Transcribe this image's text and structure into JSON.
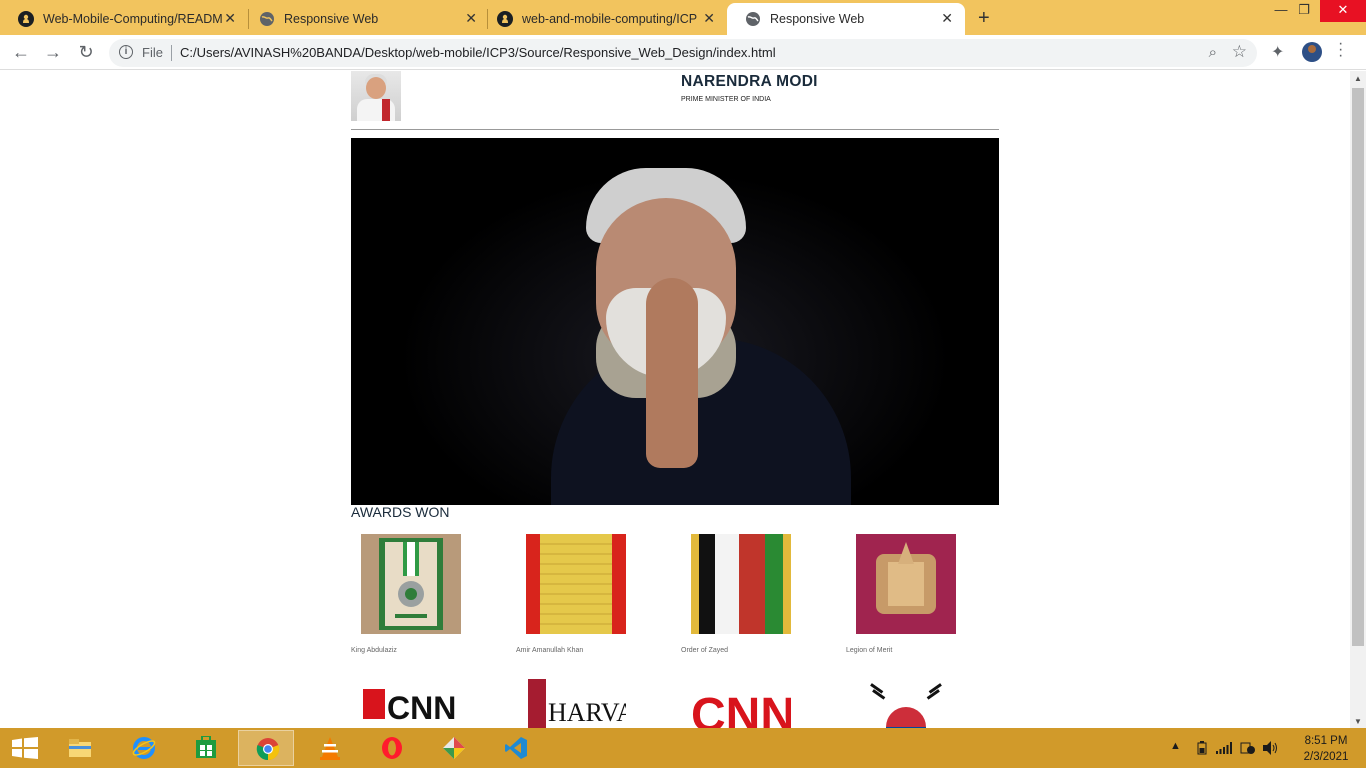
{
  "browser": {
    "tabs": [
      {
        "title": "Web-Mobile-Computing/READM",
        "favicon": "github-icon",
        "active": false
      },
      {
        "title": "Responsive Web",
        "favicon": "globe-icon",
        "active": false
      },
      {
        "title": "web-and-mobile-computing/ICP",
        "favicon": "github-icon",
        "active": false
      },
      {
        "title": "Responsive Web",
        "favicon": "globe-icon",
        "active": true
      }
    ],
    "new_tab": "+",
    "address": {
      "scheme_label": "File",
      "url": "C:/Users/AVINASH%20BANDA/Desktop/web-mobile/ICP3/Source/Responsive_Web_Design/index.html"
    },
    "accent_color": "#f2c45e"
  },
  "page": {
    "header": {
      "name": "NARENDRA MODI",
      "subtitle": "PRIME MINISTER OF INDIA"
    },
    "awards_title": "AWARDS WON",
    "awards": [
      {
        "label": "King Abdulaziz",
        "icon": "medal-icon"
      },
      {
        "label": "Amir Amanullah Khan",
        "icon": "ribbon-icon"
      },
      {
        "label": "Order of Zayed",
        "icon": "ribbon-icon"
      },
      {
        "label": "Legion of Merit",
        "icon": "ribbon-icon"
      }
    ],
    "more_awards": [
      {
        "text": "CNN HEROES",
        "icon": "cnn-heroes-logo"
      },
      {
        "text": "HARVARD",
        "icon": "harvard-logo"
      },
      {
        "text": "CNN",
        "icon": "cnn-logo"
      },
      {
        "text": "",
        "icon": "korea-flag-icon"
      }
    ]
  },
  "taskbar": {
    "apps": [
      "file-explorer-icon",
      "internet-explorer-icon",
      "store-icon",
      "chrome-icon",
      "vlc-icon",
      "opera-icon",
      "paint-icon",
      "vscode-icon"
    ],
    "active_app": "chrome-icon",
    "time": "8:51 PM",
    "date": "2/3/2021",
    "color": "#d19a2a"
  }
}
